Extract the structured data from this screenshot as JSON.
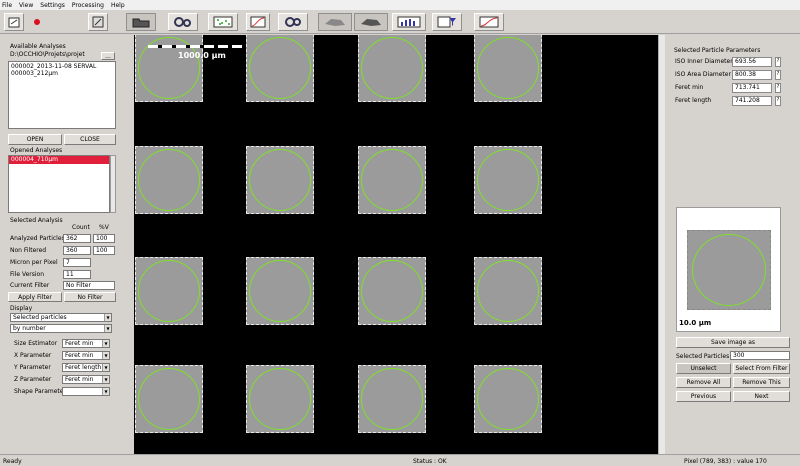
{
  "menu": [
    "File",
    "View",
    "Settings",
    "Processing",
    "Help"
  ],
  "toolbar": {
    "icons": [
      "open-project-icon",
      "record-icon",
      "save-icon",
      "open-folder-icon",
      "gears-icon",
      "scatter-plot-icon",
      "curve-plot-icon",
      "settings-icon",
      "rock-icon",
      "hand-rock-icon",
      "histogram-icon",
      "filter-chart-icon",
      "curve-chart-icon"
    ]
  },
  "left": {
    "available_title": "Available Analyses",
    "path": "D:\\OCCHIO\\Projets\\projet",
    "path_btn": "...",
    "analyses": [
      "000002_2013-11-08 SERVAL",
      "000003_212µm"
    ],
    "open_btn": "OPEN",
    "close_btn": "CLOSE",
    "opened_title": "Opened Analyses",
    "opened": [
      "000004_710µm"
    ],
    "selected_title": "Selected Analysis",
    "col_count": "Count",
    "col_pct": "%V",
    "rows": [
      {
        "label": "Analyzed Particles",
        "count": "362",
        "pct": "100"
      },
      {
        "label": "Non Filtered",
        "count": "360",
        "pct": "100"
      }
    ],
    "micron_label": "Micron per Pixel",
    "micron_value": "7",
    "file_version_label": "File Version",
    "file_version_value": "11",
    "current_filter_label": "Current Filter",
    "current_filter_value": "No Filter",
    "apply_filter_btn": "Apply Filter",
    "no_filter_btn": "No Filter",
    "display_title": "Display",
    "display_sel1": "Selected particles",
    "display_sel2": "by number",
    "params": [
      {
        "label": "Size Estimator",
        "value": "Feret min"
      },
      {
        "label": "X Parameter",
        "value": "Feret min"
      },
      {
        "label": "Y Parameter",
        "value": "Feret length"
      },
      {
        "label": "Z Parameter",
        "value": "Feret min"
      },
      {
        "label": "Shape Parameter",
        "value": ""
      }
    ]
  },
  "viewer": {
    "scale_text": "1000.0 µm"
  },
  "right": {
    "title": "Selected Particle Parameters",
    "params": [
      {
        "label": "ISO Inner Diameter",
        "value": "693.56",
        "q": "?"
      },
      {
        "label": "ISO Area Diameter",
        "value": "800.38",
        "q": "?"
      },
      {
        "label": "Feret min",
        "value": "713.741",
        "q": "?"
      },
      {
        "label": "Feret length",
        "value": "741.208",
        "q": "?"
      }
    ],
    "thumb_scale": "10.0 µm",
    "save_image_btn": "Save image as",
    "selected_particles_label": "Selected Particles",
    "selected_particles_value": "300",
    "unselect_btn": "Unselect",
    "select_from_filter_btn": "Select From Filter",
    "remove_all_btn": "Remove All",
    "remove_this_btn": "Remove This",
    "previous_btn": "Previous",
    "next_btn": "Next"
  },
  "status": {
    "left": "Ready",
    "center": "Status : OK",
    "right": "Pixel (789, 383) : value 170"
  }
}
